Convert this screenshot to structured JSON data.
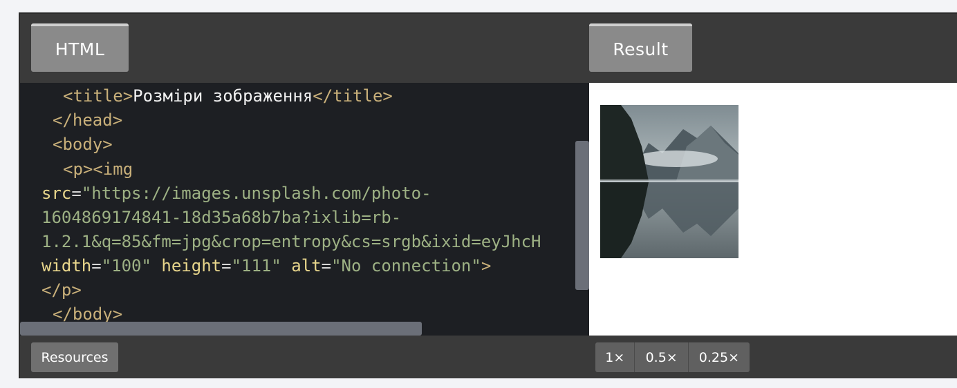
{
  "tabs": {
    "left": "HTML",
    "right": "Result"
  },
  "code": {
    "line1": {
      "open_tag": "<title>",
      "text": "Розміри зображення",
      "close_tag": "</title>"
    },
    "line2": "</head>",
    "line3": "<body>",
    "line4": "<p><img",
    "line5": {
      "attr": "src",
      "eq": "=",
      "value": "\"https://images.unsplash.com/photo-"
    },
    "line6": "1604869174841-18d35a68b7ba?ixlib=rb-",
    "line7": "1.2.1&q=85&fm=jpg&crop=entropy&cs=srgb&ixid=eyJhcH",
    "line8": {
      "width_attr": "width",
      "width_val": "\"100\"",
      "height_attr": "height",
      "height_val": "\"111\"",
      "alt_attr": "alt",
      "alt_val": "\"No connection\"",
      "close": ">"
    },
    "line9": "</p>",
    "line10": "</body>"
  },
  "footer": {
    "resources": "Resources",
    "zoom_options": [
      "1×",
      "0.5×",
      "0.25×"
    ]
  },
  "colors": {
    "code_bg": "#1d1f23",
    "tag": "#c9b07a",
    "string": "#9db184",
    "attribute": "#e8d68c",
    "chrome_bg": "#3a3a3a",
    "tab_bg": "#8a8a8a"
  },
  "icons": {
    "result_image": "mountain-lake-photo-image"
  }
}
